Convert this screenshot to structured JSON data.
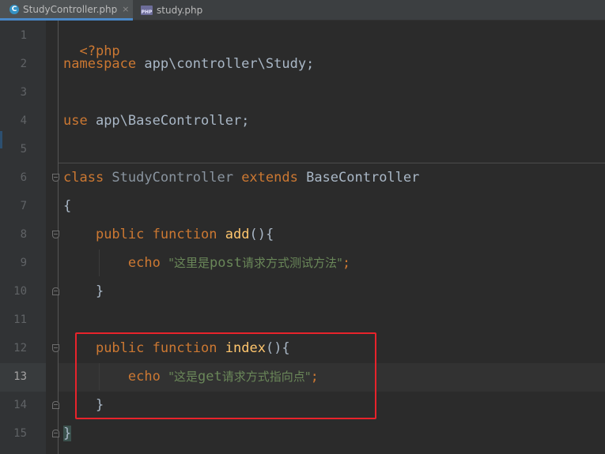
{
  "tabs": [
    {
      "label": "StudyController.php",
      "icon": "php-class-icon",
      "active": true,
      "close": "×"
    },
    {
      "label": "study.php",
      "icon": "php-file-icon",
      "active": false,
      "icon_text": "PHP"
    }
  ],
  "editor": {
    "current_line": 13,
    "lines": [
      {
        "num": "1"
      },
      {
        "num": "2"
      },
      {
        "num": "3"
      },
      {
        "num": "4"
      },
      {
        "num": "5"
      },
      {
        "num": "6"
      },
      {
        "num": "7"
      },
      {
        "num": "8"
      },
      {
        "num": "9"
      },
      {
        "num": "10"
      },
      {
        "num": "11"
      },
      {
        "num": "12"
      },
      {
        "num": "13"
      },
      {
        "num": "14"
      },
      {
        "num": "15"
      }
    ],
    "code": {
      "l1": "<?php",
      "l2_kw": "namespace",
      "l2_rest": " app\\controller\\Study;",
      "l4_kw": "use",
      "l4_rest": " app\\BaseController;",
      "l6_kw1": "class",
      "l6_cls": " StudyController ",
      "l6_kw2": "extends",
      "l6_base": " BaseController",
      "l7": "{",
      "l8_kw1": "public",
      "l8_kw2": "function",
      "l8_fn": "add",
      "l8_rest": "(){",
      "l9_kw": "echo",
      "l9_str1": "\"这里是",
      "l9_str2": "post",
      "l9_str3": "请求方式测试方法\"",
      "l9_semi": ";",
      "l10": "}",
      "l12_kw1": "public",
      "l12_kw2": "function",
      "l12_fn": "index",
      "l12_rest": "(){",
      "l13_kw": "echo",
      "l13_str1": "\"这是",
      "l13_str2": "get",
      "l13_str3": "请求方式指向点\"",
      "l13_semi": ";",
      "l14": "}",
      "l15": "}"
    }
  },
  "colors": {
    "background": "#2b2b2b",
    "keyword": "#cc7832",
    "function": "#ffc66d",
    "string": "#6a8759",
    "plain": "#a9b7c6",
    "highlight_box": "#e8232b"
  }
}
